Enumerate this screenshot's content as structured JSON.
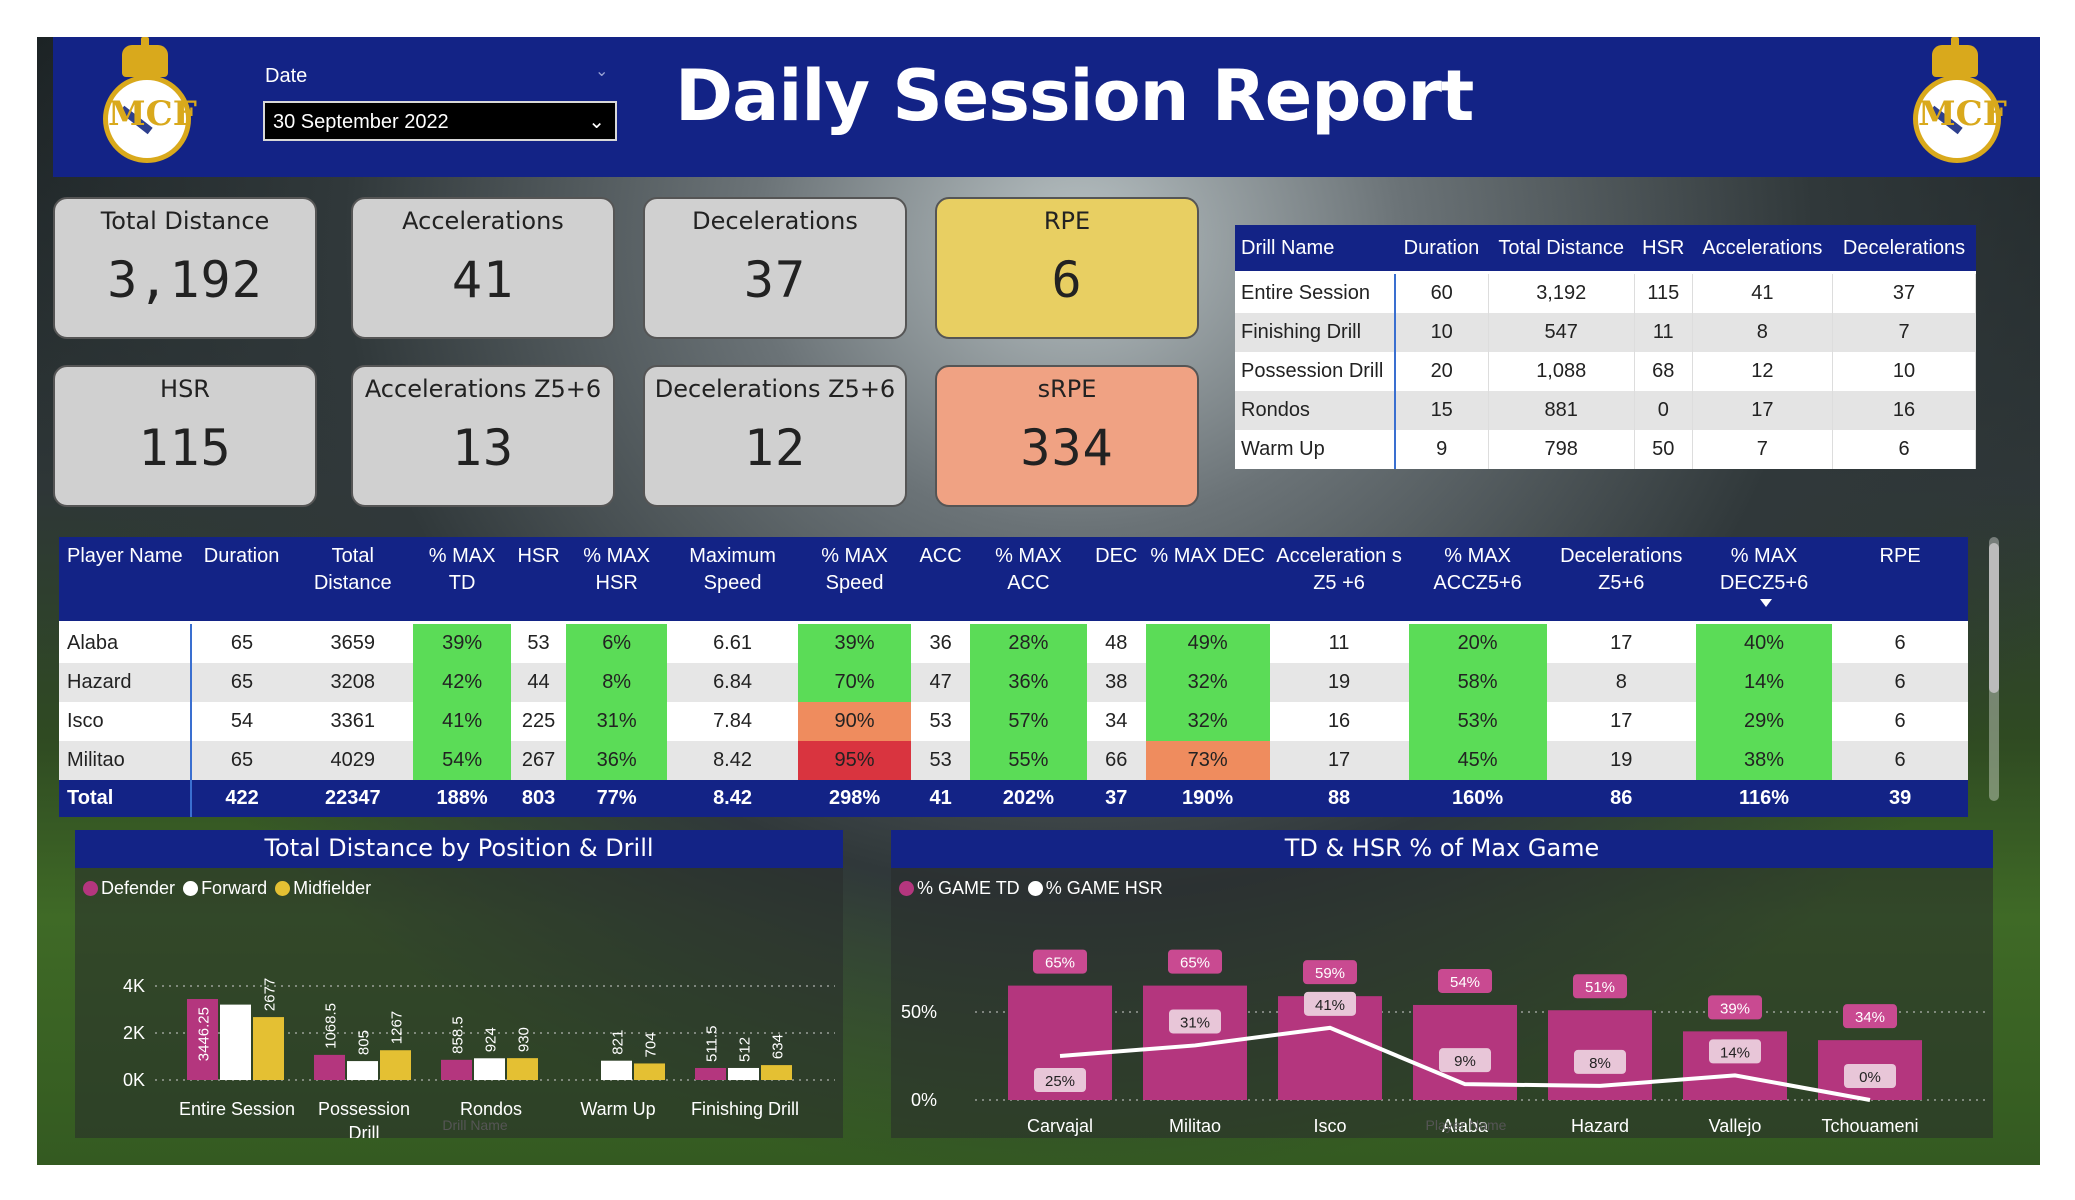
{
  "header": {
    "title": "Daily Session Report",
    "date_label": "Date",
    "date_value": "30 September 2022",
    "logo": "real-madrid-crest",
    "logo_text": "MCF"
  },
  "kpis": [
    {
      "label": "Total Distance",
      "value": "3,192",
      "color": "#d0d0d0"
    },
    {
      "label": "Accelerations",
      "value": "41",
      "color": "#d0d0d0"
    },
    {
      "label": "Decelerations",
      "value": "37",
      "color": "#d0d0d0"
    },
    {
      "label": "RPE",
      "value": "6",
      "color": "#e8cf62"
    },
    {
      "label": "HSR",
      "value": "115",
      "color": "#d0d0d0"
    },
    {
      "label": "Accelerations Z5+6",
      "value": "13",
      "color": "#d0d0d0"
    },
    {
      "label": "Decelerations Z5+6",
      "value": "12",
      "color": "#d0d0d0"
    },
    {
      "label": "sRPE",
      "value": "334",
      "color": "#f0a283"
    }
  ],
  "drill_table": {
    "headers": [
      "Drill Name",
      "Duration",
      "Total Distance",
      "HSR",
      "Accelerations",
      "Decelerations"
    ],
    "rows": [
      [
        "Entire Session",
        "60",
        "3,192",
        "115",
        "41",
        "37"
      ],
      [
        "Finishing Drill",
        "10",
        "547",
        "11",
        "8",
        "7"
      ],
      [
        "Possession Drill",
        "20",
        "1,088",
        "68",
        "12",
        "10"
      ],
      [
        "Rondos",
        "15",
        "881",
        "0",
        "17",
        "16"
      ],
      [
        "Warm Up",
        "9",
        "798",
        "50",
        "7",
        "6"
      ]
    ]
  },
  "player_table": {
    "headers": [
      "Player Name",
      "Duration",
      "Total Distance",
      "% MAX TD",
      "HSR",
      "% MAX HSR",
      "Maximum Speed",
      "% MAX Speed",
      "ACC",
      "% MAX ACC",
      "DEC",
      "% MAX DEC",
      "Acceleration s Z5 +6",
      "% MAX ACCZ5+6",
      "Decelerations Z5+6",
      "% MAX DECZ5+6",
      "RPE"
    ],
    "sort_icon": "sort-descending-icon",
    "rows": [
      [
        "Alaba",
        "65",
        "3659",
        "39%",
        "53",
        "6%",
        "6.61",
        "39%",
        "36",
        "28%",
        "48",
        "49%",
        "11",
        "20%",
        "17",
        "40%",
        "6"
      ],
      [
        "Hazard",
        "65",
        "3208",
        "42%",
        "44",
        "8%",
        "6.84",
        "70%",
        "47",
        "36%",
        "38",
        "32%",
        "19",
        "58%",
        "8",
        "14%",
        "6"
      ],
      [
        "Isco",
        "54",
        "3361",
        "41%",
        "225",
        "31%",
        "7.84",
        "90%",
        "53",
        "57%",
        "34",
        "32%",
        "16",
        "53%",
        "17",
        "29%",
        "6"
      ],
      [
        "Militao",
        "65",
        "4029",
        "54%",
        "267",
        "36%",
        "8.42",
        "95%",
        "53",
        "55%",
        "66",
        "73%",
        "17",
        "45%",
        "19",
        "38%",
        "6"
      ]
    ],
    "total": [
      "Total",
      "422",
      "22347",
      "188%",
      "803",
      "77%",
      "8.42",
      "298%",
      "41",
      "202%",
      "37",
      "190%",
      "88",
      "160%",
      "86",
      "116%",
      "39"
    ],
    "cell_colors": {
      "green": "#5bdc57",
      "orange": "#ef8c5e",
      "red": "#d9343f"
    },
    "highlight": {
      "0": {
        "3": "green",
        "5": "green",
        "7": "green",
        "9": "green",
        "11": "green",
        "13": "green",
        "15": "green"
      },
      "1": {
        "3": "green",
        "5": "green",
        "7": "green",
        "9": "green",
        "11": "green",
        "13": "green",
        "15": "green"
      },
      "2": {
        "3": "green",
        "5": "green",
        "7": "orange",
        "9": "green",
        "11": "green",
        "13": "green",
        "15": "green"
      },
      "3": {
        "3": "green",
        "5": "green",
        "7": "red",
        "9": "green",
        "11": "orange",
        "13": "green",
        "15": "green"
      }
    }
  },
  "chart_data": [
    {
      "type": "bar",
      "title": "Total Distance by Position & Drill",
      "xlabel": "Drill Name",
      "ylabel": "",
      "categories": [
        "Entire Session",
        "Possession Drill",
        "Rondos",
        "Warm Up",
        "Finishing Drill"
      ],
      "series": [
        {
          "name": "Defender",
          "color": "#b4367e",
          "values": [
            3446.25,
            1068.5,
            858.5,
            null,
            511.5
          ],
          "labels": [
            "3446.25",
            "1068.5",
            "858.5",
            "",
            "511.5"
          ]
        },
        {
          "name": "Forward",
          "color": "#ffffff",
          "values": [
            3208,
            805,
            924,
            821,
            512
          ],
          "labels": [
            "",
            "805",
            "924",
            "821",
            "512"
          ]
        },
        {
          "name": "Midfielder",
          "color": "#e4c033",
          "values": [
            2677,
            1267,
            930,
            704,
            634
          ],
          "labels": [
            "2677",
            "1267",
            "930",
            "704",
            "634"
          ]
        }
      ],
      "y_ticks": [
        "0K",
        "2K",
        "4K"
      ],
      "ylim": [
        0,
        4200
      ],
      "legend": "top-left"
    },
    {
      "type": "bar",
      "title": "TD & HSR % of Max Game",
      "xlabel": "Player Name",
      "ylabel": "",
      "categories": [
        "Carvajal",
        "Militao",
        "Isco",
        "Alaba",
        "Hazard",
        "Vallejo",
        "Tchouameni"
      ],
      "series": [
        {
          "name": "% GAME TD",
          "type": "bar",
          "color": "#b4367e",
          "values": [
            65,
            65,
            59,
            54,
            51,
            39,
            34
          ],
          "labels": [
            "65%",
            "65%",
            "59%",
            "54%",
            "51%",
            "39%",
            "34%"
          ]
        },
        {
          "name": "% GAME HSR",
          "type": "line",
          "color": "#ffffff",
          "values": [
            25,
            31,
            41,
            9,
            8,
            14,
            0
          ],
          "labels": [
            "25%",
            "31%",
            "41%",
            "9%",
            "8%",
            "14%",
            "0%"
          ]
        }
      ],
      "y_ticks": [
        "0%",
        "50%"
      ],
      "ylim": [
        0,
        75
      ],
      "legend": "top-left"
    }
  ]
}
